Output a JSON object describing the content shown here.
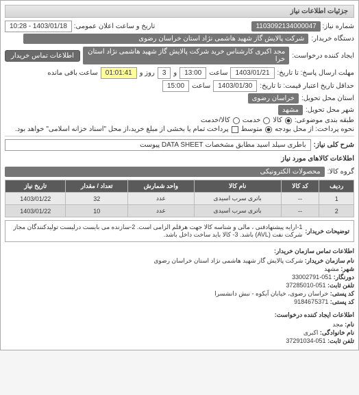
{
  "header": {
    "title": "جزئیات اطلاعات نیاز"
  },
  "top": {
    "req_no_label": "شماره نیاز:",
    "req_no": "1103092134000047",
    "pub_dt_label": "تاریخ و ساعت اعلان عمومی:",
    "pub_dt": "1403/01/18 - 10:28",
    "buyer_label": "دستگاه خریدار:",
    "buyer": "شرکت پالایش گاز شهید هاشمی نژاد   استان خراسان رضوی",
    "creator_label": "ایجاد کننده درخواست:",
    "creator": "مجد اکبری کارشناس خرید شرکت پالایش گاز شهید هاشمی نژاد   استان خرا",
    "contact_btn": "اطلاعات تماس خریدار",
    "deadline_send_label": "مهلت ارسال پاسخ: تا تاریخ:",
    "deadline_send_date": "1403/01/21",
    "time_label": "ساعت",
    "deadline_send_time": "13:00",
    "remain_label": "و",
    "remain_days": "3",
    "remain_days_label": "روز و",
    "remain_time": "01:01:41",
    "remain_suffix": "ساعت باقی مانده",
    "validity_label": "حداقل تاریخ اعتبار قیمت: تا تاریخ:",
    "validity_date": "1403/01/30",
    "validity_time": "15:00",
    "province_label": "استان محل تحویل:",
    "province": "خراسان رضوی",
    "city_label": "شهر محل تحویل:",
    "city": "مشهد",
    "subject_cat_label": "طبقه بندی موضوعی:",
    "r_goods": "کالا",
    "r_service": "خدمت",
    "r_both": "کالا/خدمت",
    "budget_type_label": "نحوه پرداخت: از محل بودجه",
    "r_medium": "متوسط",
    "budget_note": "پرداخت تمام یا بخشی از مبلغ خرید،از محل \"اسناد خزانه اسلامی\" خواهد بود.",
    "keyword_label": "شرح کلی نیاز:",
    "keyword": "باطری سیلد اسید مطابق مشخصات DATA SHEET پیوست"
  },
  "goods_header": "اطلاعات کالاهای مورد نیاز",
  "group_label": "گروه کالا:",
  "group_val": "محصولات الکترونیکی",
  "tbl": {
    "h_row": "ردیف",
    "h_code": "کد کالا",
    "h_name": "نام کالا",
    "h_unit": "واحد شمارش",
    "h_qty": "تعداد / مقدار",
    "h_date": "تاریخ نیاز",
    "rows": [
      {
        "row": "1",
        "code": "--",
        "name": "باتری سرب اسیدی",
        "unit": "عدد",
        "qty": "32",
        "date": "1403/01/22"
      },
      {
        "row": "2",
        "code": "--",
        "name": "باتری سرب اسیدی",
        "unit": "عدد",
        "qty": "10",
        "date": "1403/01/22"
      }
    ]
  },
  "notes_label": "توضیحات خریدار:",
  "notes": "1-ارایه پیشنهادفنی ، مالی و شناسه کالا جهت هرقلم الزامی است. 2-سازنده می بایست درلیست تولیدکنندگان مجاز شرکت نفت (AVL) باشد. 3- کالا باید ساخت داخل باشد.",
  "contact1": {
    "title": "اطلاعات تماس سازمان خریدار:",
    "org_label": "نام سازمان خریدار:",
    "org": "شرکت پالایش گاز شهید هاشمی نژاد استان خراسان رضوی",
    "city_label": "شهر:",
    "city": "مشهد",
    "switch_label": "دورنگار:",
    "switch": "051-33002791",
    "fax_label": "تلفن ثابت:",
    "fax": "051-37285010",
    "addr_label": "کد پستی:",
    "addr": "خراسان رضوی، خیابان آبکوه - نبش دانشسرا",
    "post_label": "کد پستی:",
    "post": "9184675371"
  },
  "contact2": {
    "title": "اطلاعات ایجاد کننده درخواست:",
    "name_label": "نام:",
    "name": "مجد",
    "lname_label": "نام خانوادگی:",
    "lname": "اکبری",
    "phone_label": "تلفن ثابت:",
    "phone": "051-37291034"
  }
}
